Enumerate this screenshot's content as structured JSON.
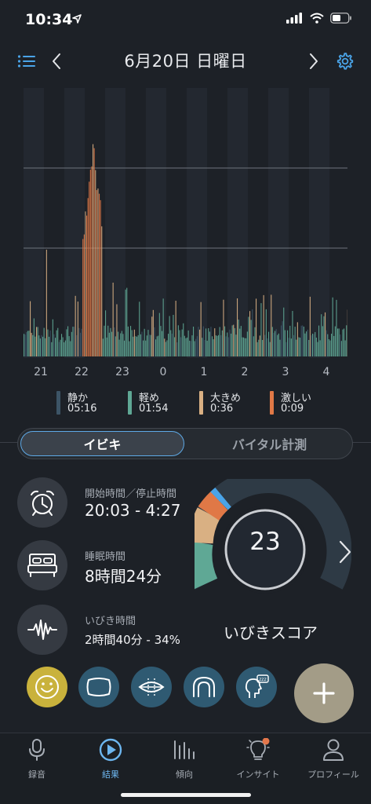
{
  "status": {
    "time": "10:34"
  },
  "header": {
    "title": "6月20日 日曜日"
  },
  "chart_data": {
    "type": "bar",
    "x_ticks": [
      "21",
      "22",
      "23",
      "0",
      "1",
      "2",
      "3",
      "4"
    ],
    "legend": [
      {
        "label": "静か",
        "value": "05:16",
        "color": "#3c5466"
      },
      {
        "label": "軽め",
        "value": "01:54",
        "color": "#5fa895"
      },
      {
        "label": "大きめ",
        "value": "0:36",
        "color": "#d9b083"
      },
      {
        "label": "激しい",
        "value": "0:09",
        "color": "#e07846"
      }
    ]
  },
  "tabs": {
    "snore": "イビキ",
    "vitals": "バイタル計測"
  },
  "stats": {
    "start_stop_label": "開始時間／停止時間",
    "start_stop_value": "20:03 - 4:27",
    "sleep_label": "睡眠時間",
    "sleep_value": "8時間24分",
    "snore_label": "いびき時間",
    "snore_value": "2時間40分 - 34%"
  },
  "score": {
    "value": "23",
    "caption": "いびきスコア"
  },
  "bottom_nav": [
    {
      "label": "録音"
    },
    {
      "label": "結果"
    },
    {
      "label": "傾向"
    },
    {
      "label": "インサイト"
    },
    {
      "label": "プロフィール"
    }
  ]
}
